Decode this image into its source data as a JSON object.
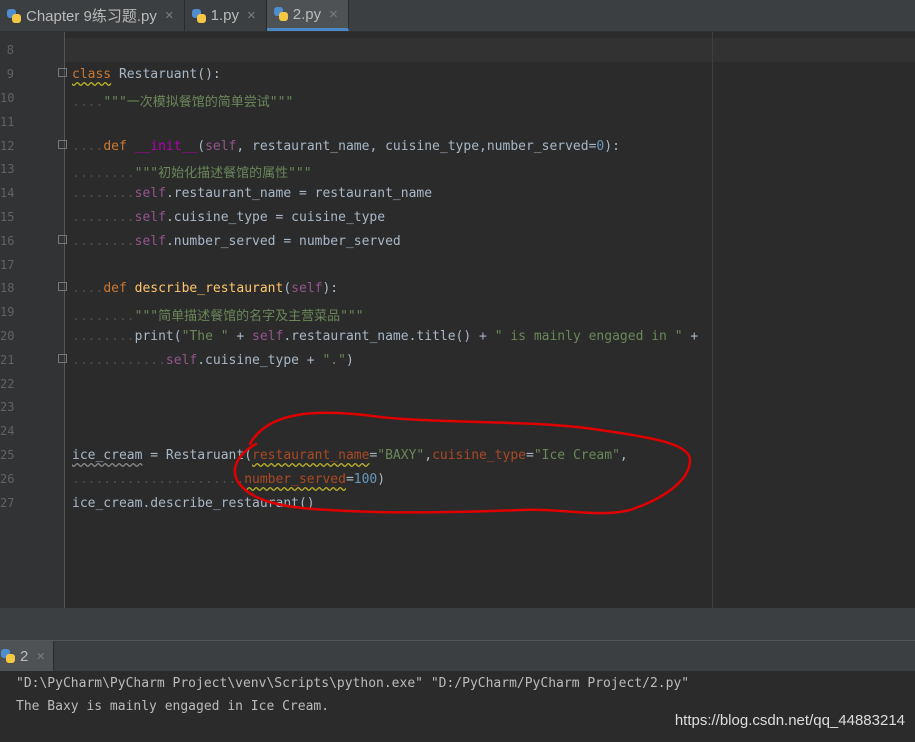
{
  "tabs": [
    {
      "label": "Chapter 9练习题.py",
      "active": false
    },
    {
      "label": "1.py",
      "active": false
    },
    {
      "label": "2.py",
      "active": true
    }
  ],
  "line_numbers": [
    "8",
    "9",
    "10",
    "11",
    "12",
    "13",
    "14",
    "15",
    "16",
    "17",
    "18",
    "19",
    "20",
    "21",
    "22",
    "23",
    "24",
    "25",
    "26",
    "27"
  ],
  "code": {
    "l9_kw": "class",
    "l9_name": "Restaruant",
    "l9_rest": "():",
    "l10": "\"\"\"一次模拟餐馆的简单尝试\"\"\"",
    "l12_kw": "def",
    "l12_name": "__init__",
    "l12_open": "(",
    "l12_self": "self",
    "l12_args": ", restaurant_name, cuisine_type,number_served=",
    "l12_num": "0",
    "l12_close": "):",
    "l13": "\"\"\"初始化描述餐馆的属性\"\"\"",
    "l14_self": "self",
    "l14_rest": ".restaurant_name = restaurant_name",
    "l15_self": "self",
    "l15_rest": ".cuisine_type = cuisine_type",
    "l16_self": "self",
    "l16_rest": ".number_served = number_served",
    "l18_kw": "def",
    "l18_name": "describe_restaurant",
    "l18_open": "(",
    "l18_self": "self",
    "l18_close": "):",
    "l19": "\"\"\"简单描述餐馆的名字及主营菜品\"\"\"",
    "l20_print": "print(",
    "l20_str1": "\"The \"",
    "l20_plus1": " + ",
    "l20_self": "self",
    "l20_mid": ".restaurant_name.title() + ",
    "l20_str2": "\" is mainly engaged in \"",
    "l20_plus2": " +",
    "l21_self": "self",
    "l21_mid": ".cuisine_type + ",
    "l21_str": "\".\"",
    "l21_close": ")",
    "l25_var": "ice_cream",
    "l25_eq": " = Restaruant(",
    "l25_p1": "restaurant_name",
    "l25_eq1": "=",
    "l25_s1": "\"BAXY\"",
    "l25_comma": ",",
    "l25_p2": "cuisine_type",
    "l25_eq2": "=",
    "l25_s2": "\"Ice Cream\"",
    "l25_end": ",",
    "l26_p3": "number_served",
    "l26_eq": "=",
    "l26_num": "100",
    "l26_close": ")",
    "l27": "ice_cream.describe_restaurant()"
  },
  "run": {
    "tab_label": "2"
  },
  "console": {
    "line1": "\"D:\\PyCharm\\PyCharm Project\\venv\\Scripts\\python.exe\" \"D:/PyCharm/PyCharm Project/2.py\"",
    "line2": "The Baxy is mainly engaged in Ice Cream."
  },
  "watermark": "https://blog.csdn.net/qq_44883214",
  "colors": {
    "annotation": "#e00000",
    "keyword": "#cc7832",
    "string": "#6a8759"
  }
}
